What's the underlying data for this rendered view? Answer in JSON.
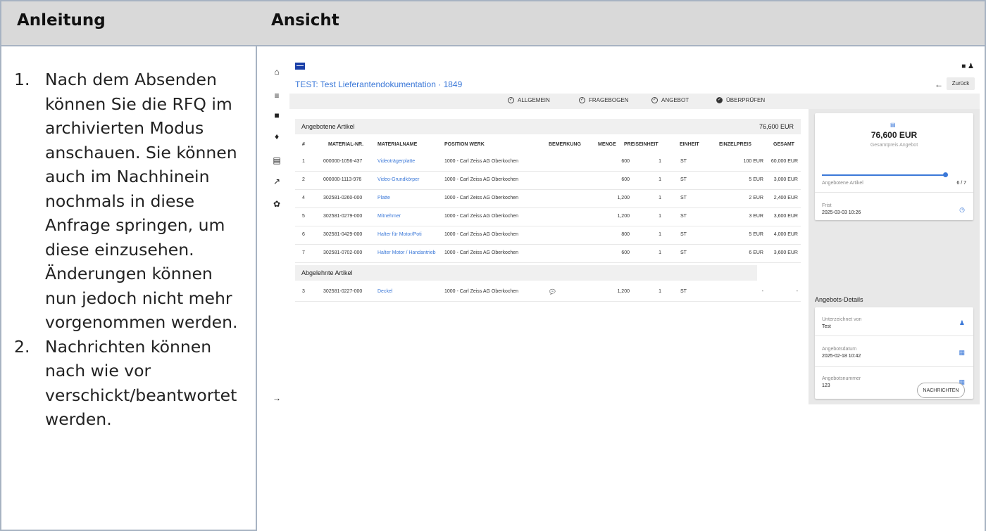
{
  "doc": {
    "left_header": "Anleitung",
    "right_header": "Ansicht",
    "steps": [
      {
        "num": "1.",
        "text": "Nach dem Absenden können Sie die RFQ im archivierten Modus anschauen. Sie können auch im Nachhinein nochmals in diese Anfrage springen, um diese einzusehen. Änderungen können nun jedoch nicht mehr vorgenommen werden."
      },
      {
        "num": "2.",
        "text": "Nachrichten können nach wie vor verschickt/beantwortet werden."
      }
    ]
  },
  "app": {
    "title": "TEST: Test Lieferantendokumentation  ·  1849",
    "back_label": "Zurück",
    "steps": [
      "ALLGEMEIN",
      "FRAGEBOGEN",
      "ANGEBOT",
      "ÜBERPRÜFEN"
    ],
    "offered": {
      "label": "Angebotene Artikel",
      "total": "76,600 EUR",
      "columns": [
        "#",
        "MATERIAL-NR.",
        "MATERIALNAME",
        "POSITION WERK",
        "BEMERKUNG",
        "MENGE",
        "PREISEINHEIT",
        "EINHEIT",
        "EINZELPREIS",
        "GESAMT"
      ],
      "rows": [
        {
          "no": "1",
          "mat": "000000-1056-437",
          "name": "Videoträgerplatte",
          "pos": "1000 - Carl Zeiss AG Oberkochen",
          "bem": "",
          "menge": "600",
          "preis": "1",
          "einh": "ST",
          "ep": "100 EUR",
          "ges": "60,000 EUR"
        },
        {
          "no": "2",
          "mat": "000000-1113-976",
          "name": "Video-Grundkörper",
          "pos": "1000 - Carl Zeiss AG Oberkochen",
          "bem": "",
          "menge": "600",
          "preis": "1",
          "einh": "ST",
          "ep": "5 EUR",
          "ges": "3,000 EUR"
        },
        {
          "no": "4",
          "mat": "302581-0260-000",
          "name": "Platte",
          "pos": "1000 - Carl Zeiss AG Oberkochen",
          "bem": "",
          "menge": "1,200",
          "preis": "1",
          "einh": "ST",
          "ep": "2 EUR",
          "ges": "2,400 EUR"
        },
        {
          "no": "5",
          "mat": "302581-0279-000",
          "name": "Mitnehmer",
          "pos": "1000 - Carl Zeiss AG Oberkochen",
          "bem": "",
          "menge": "1,200",
          "preis": "1",
          "einh": "ST",
          "ep": "3 EUR",
          "ges": "3,600 EUR"
        },
        {
          "no": "6",
          "mat": "302581-0429-000",
          "name": "Halter für Motor/Poti",
          "pos": "1000 - Carl Zeiss AG Oberkochen",
          "bem": "",
          "menge": "800",
          "preis": "1",
          "einh": "ST",
          "ep": "5 EUR",
          "ges": "4,000 EUR"
        },
        {
          "no": "7",
          "mat": "302581-0702-000",
          "name": "Halter Motor / Handantrieb",
          "pos": "1000 - Carl Zeiss AG Oberkochen",
          "bem": "",
          "menge": "600",
          "preis": "1",
          "einh": "ST",
          "ep": "6 EUR",
          "ges": "3,600 EUR"
        }
      ]
    },
    "rejected": {
      "label": "Abgelehnte Artikel",
      "rows": [
        {
          "no": "3",
          "mat": "302581-0227-000",
          "name": "Deckel",
          "pos": "1000 - Carl Zeiss AG Oberkochen",
          "bem": "💬",
          "menge": "1,200",
          "preis": "1",
          "einh": "ST",
          "ep": "-",
          "ges": "-"
        }
      ]
    },
    "summary": {
      "total": "76,600 EUR",
      "total_label": "Gesamtpreis Angebot",
      "articles_label": "Angebotene Artikel",
      "articles_value": "6 / 7",
      "articles_fraction": 0.857,
      "deadline_label": "Frist",
      "deadline_value": "2025-03-03 10:26"
    },
    "details": {
      "title": "Angebots-Details",
      "signed_label": "Unterzeichnet von",
      "signed_value": "Test",
      "date_label": "Angebotsdatum",
      "date_value": "2025-02-18 10:42",
      "number_label": "Angebotsnummer",
      "number_value": "123"
    },
    "messages_button": "NACHRICHTEN",
    "accent": "#3b78d8"
  }
}
